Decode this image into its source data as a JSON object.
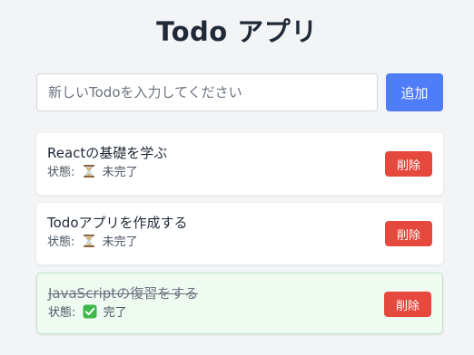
{
  "app": {
    "title": "Todo アプリ"
  },
  "form": {
    "placeholder": "新しいTodoを入力してください",
    "value": "",
    "add_label": "追加"
  },
  "todos": [
    {
      "text": "Reactの基礎を学ぶ",
      "status_label": "状態:",
      "status_icon": "hourglass-icon",
      "status_text": "未完了",
      "completed": false,
      "delete_label": "削除"
    },
    {
      "text": "Todoアプリを作成する",
      "status_label": "状態:",
      "status_icon": "hourglass-icon",
      "status_text": "未完了",
      "completed": false,
      "delete_label": "削除"
    },
    {
      "text": "JavaScriptの復習をする",
      "status_label": "状態:",
      "status_icon": "check-icon",
      "status_text": "完了",
      "completed": true,
      "delete_label": "削除"
    }
  ],
  "colors": {
    "primary": "#4f7cf7",
    "danger": "#e5483d",
    "completed_bg": "#effbf1",
    "completed_border": "#bde5c4",
    "check": "#3cb94a",
    "background": "#f3f4f6"
  }
}
